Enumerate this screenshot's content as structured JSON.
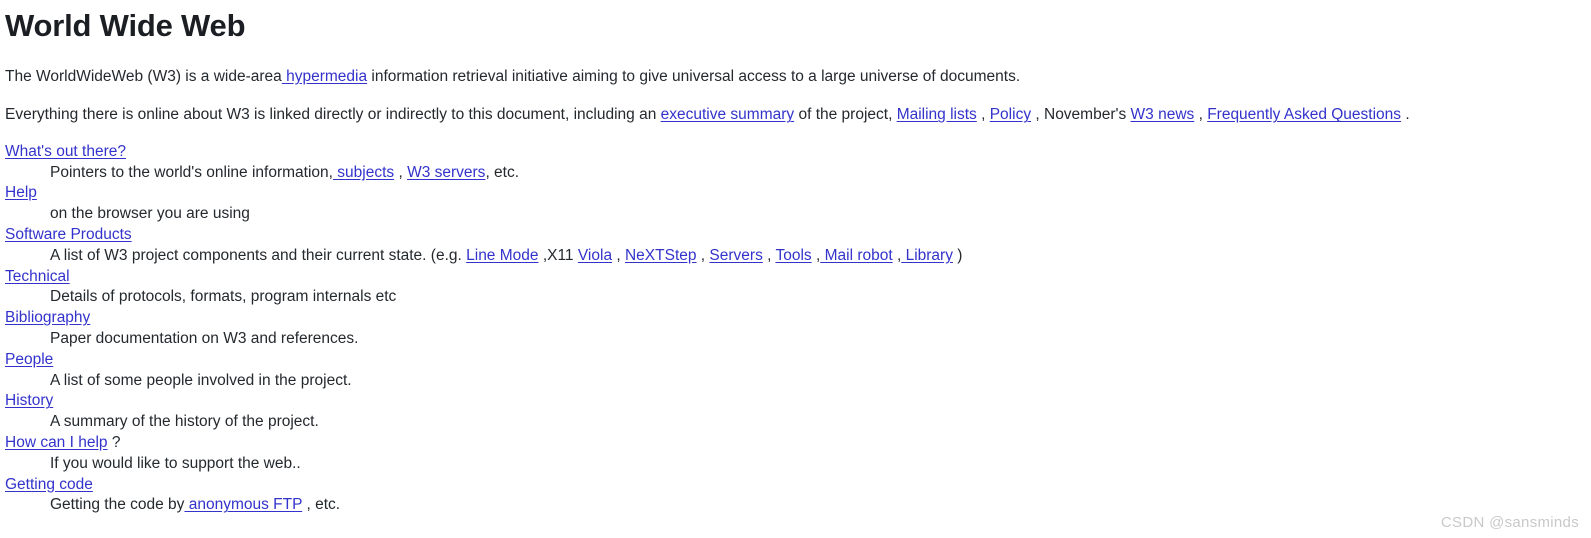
{
  "document": {
    "title": "World Wide Web",
    "paragraphs": [
      {
        "id": "intro",
        "segments": [
          {
            "type": "text",
            "text": "The WorldWideWeb (W3) is a wide-area"
          },
          {
            "type": "link",
            "text": " hypermedia"
          },
          {
            "type": "text",
            "text": " information retrieval initiative aiming to give universal access to a large universe of documents."
          }
        ]
      },
      {
        "id": "everything",
        "segments": [
          {
            "type": "text",
            "text": "Everything there is online about W3 is linked directly or indirectly to this document, including an "
          },
          {
            "type": "link",
            "text": "executive summary"
          },
          {
            "type": "text",
            "text": " of the project, "
          },
          {
            "type": "link",
            "text": "Mailing lists"
          },
          {
            "type": "text",
            "text": " , "
          },
          {
            "type": "link",
            "text": "Policy"
          },
          {
            "type": "text",
            "text": " , November's "
          },
          {
            "type": "link",
            "text": "W3 news"
          },
          {
            "type": "text",
            "text": " , "
          },
          {
            "type": "link",
            "text": "Frequently Asked Questions"
          },
          {
            "type": "text",
            "text": " ."
          }
        ]
      }
    ],
    "definitions": [
      {
        "term": "What's out there?",
        "desc_segments": [
          {
            "type": "text",
            "text": "Pointers to the world's online information,"
          },
          {
            "type": "link",
            "text": " subjects"
          },
          {
            "type": "text",
            "text": " , "
          },
          {
            "type": "link",
            "text": "W3 servers"
          },
          {
            "type": "text",
            "text": ", etc."
          }
        ]
      },
      {
        "term": "Help",
        "desc_segments": [
          {
            "type": "text",
            "text": "on the browser you are using"
          }
        ]
      },
      {
        "term": "Software Products",
        "desc_segments": [
          {
            "type": "text",
            "text": "A list of W3 project components and their current state. (e.g. "
          },
          {
            "type": "link",
            "text": "Line Mode"
          },
          {
            "type": "text",
            "text": " ,X11 "
          },
          {
            "type": "link",
            "text": "Viola"
          },
          {
            "type": "text",
            "text": " , "
          },
          {
            "type": "link",
            "text": "NeXTStep"
          },
          {
            "type": "text",
            "text": " , "
          },
          {
            "type": "link",
            "text": "Servers"
          },
          {
            "type": "text",
            "text": " , "
          },
          {
            "type": "link",
            "text": "Tools"
          },
          {
            "type": "text",
            "text": " ,"
          },
          {
            "type": "link",
            "text": " Mail robot"
          },
          {
            "type": "text",
            "text": " ,"
          },
          {
            "type": "link",
            "text": " Library"
          },
          {
            "type": "text",
            "text": " )"
          }
        ]
      },
      {
        "term": "Technical",
        "desc_segments": [
          {
            "type": "text",
            "text": "Details of protocols, formats, program internals etc"
          }
        ]
      },
      {
        "term": "Bibliography",
        "desc_segments": [
          {
            "type": "text",
            "text": "Paper documentation on W3 and references."
          }
        ]
      },
      {
        "term": "People",
        "desc_segments": [
          {
            "type": "text",
            "text": "A list of some people involved in the project."
          }
        ]
      },
      {
        "term": "History",
        "desc_segments": [
          {
            "type": "text",
            "text": "A summary of the history of the project."
          }
        ]
      },
      {
        "term": "How can I help",
        "term_suffix": " ?",
        "desc_segments": [
          {
            "type": "text",
            "text": "If you would like to support the web.."
          }
        ]
      },
      {
        "term": "Getting code",
        "desc_segments": [
          {
            "type": "text",
            "text": "Getting the code by"
          },
          {
            "type": "link",
            "text": " anonymous FTP"
          },
          {
            "type": "text",
            "text": " , etc."
          }
        ]
      }
    ]
  },
  "watermark": {
    "text": "CSDN @sansminds"
  },
  "colors": {
    "link": "#3333cc",
    "text": "#24292e",
    "heading": "#1b1f23",
    "background": "#ffffff",
    "watermark": "#c9c9c9"
  }
}
